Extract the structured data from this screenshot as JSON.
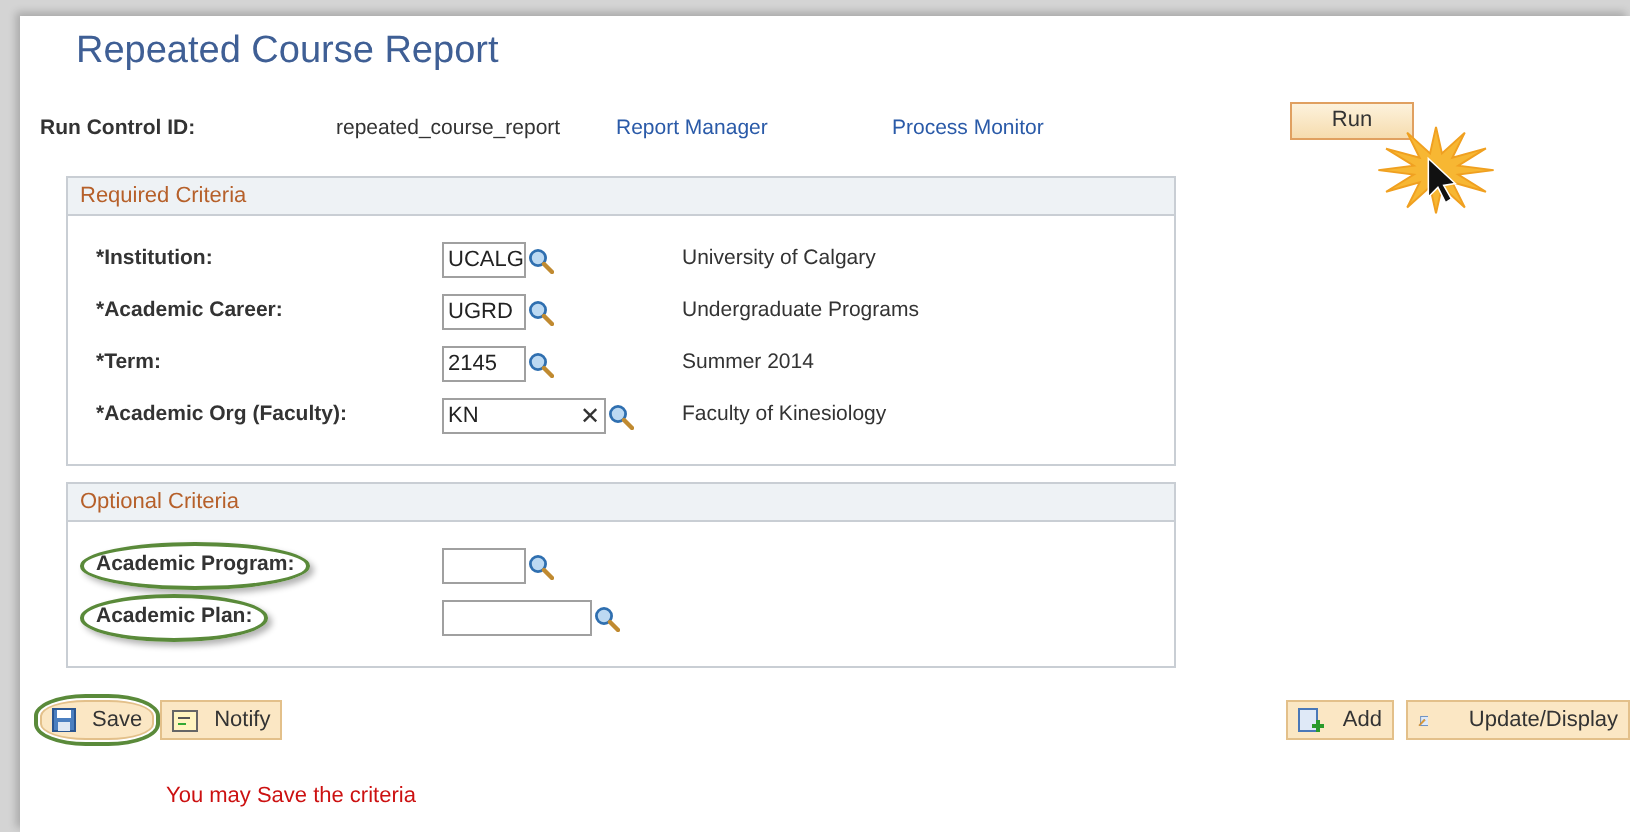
{
  "page_title": "Repeated Course Report",
  "run_control": {
    "label": "Run Control ID:",
    "value": "repeated_course_report",
    "links": [
      "Report Manager",
      "Process Monitor"
    ],
    "run_button": {
      "label": "Run",
      "clicked": true
    }
  },
  "sections": [
    {
      "title": "Required Criteria",
      "fields": [
        {
          "label": "*Institution:",
          "value": "UCALG",
          "description": "University of Calgary",
          "highlighted": false
        },
        {
          "label": "*Academic Career:",
          "value": "UGRD",
          "description": "Undergraduate Programs",
          "highlighted": false
        },
        {
          "label": "*Term:",
          "value": "2145",
          "description": "Summer 2014",
          "highlighted": false
        },
        {
          "label": "*Academic Org (Faculty):",
          "value": "KN",
          "clear_icon": "✕",
          "description": "Faculty of Kinesiology",
          "highlighted": false
        }
      ]
    },
    {
      "title": "Optional Criteria",
      "fields": [
        {
          "label": "Academic Program:",
          "highlighted": true
        },
        {
          "label": "Academic Plan:",
          "highlighted": true
        }
      ]
    }
  ],
  "left_buttons": [
    {
      "kind": "save",
      "label": "Save",
      "highlighted": true
    },
    {
      "kind": "notify",
      "label": "Notify",
      "highlighted": false
    }
  ],
  "right_buttons": [
    {
      "kind": "add",
      "label": "Add"
    },
    {
      "kind": "update",
      "label": "Update/Display"
    }
  ],
  "message": "You may Save the criteria"
}
